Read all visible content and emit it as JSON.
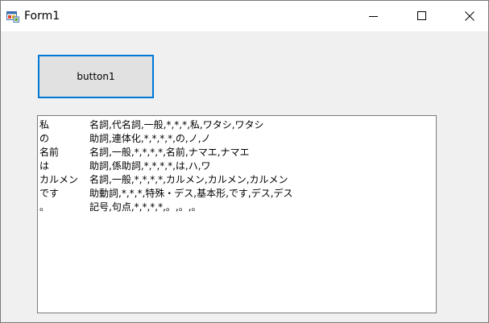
{
  "window": {
    "title": "Form1",
    "icon": "winforms-app-icon"
  },
  "controls": {
    "minimize": "minimize-icon",
    "maximize": "maximize-icon",
    "close": "close-icon"
  },
  "button1": {
    "label": "button1"
  },
  "output": {
    "rows": [
      {
        "surface": "私",
        "features": "名詞,代名詞,一般,*,*,*,私,ワタシ,ワタシ"
      },
      {
        "surface": "の",
        "features": "助詞,連体化,*,*,*,*,の,ノ,ノ"
      },
      {
        "surface": "名前",
        "features": "名詞,一般,*,*,*,*,名前,ナマエ,ナマエ"
      },
      {
        "surface": "は",
        "features": "助詞,係助詞,*,*,*,*,は,ハ,ワ"
      },
      {
        "surface": "カルメン",
        "features": "名詞,一般,*,*,*,*,カルメン,カルメン,カルメン"
      },
      {
        "surface": "です",
        "features": "助動詞,*,*,*,特殊・デス,基本形,です,デス,デス"
      },
      {
        "surface": "。",
        "features": "記号,句点,*,*,*,*,。,。,。"
      }
    ]
  }
}
